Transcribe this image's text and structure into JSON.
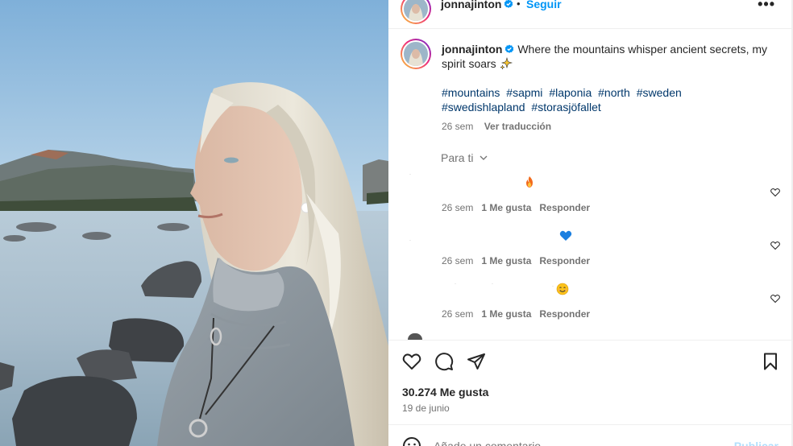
{
  "post": {
    "username": "jonnajinton",
    "separator": "•",
    "follow_label": "Seguir",
    "more_label": "•••",
    "caption_text": "Where the mountains whisper ancient secrets, my spirit soars",
    "caption_emoji": "sparkles-icon",
    "hashtags": [
      "#mountains",
      "#sapmi",
      "#laponia",
      "#north",
      "#sweden",
      "#swedishlapland",
      "#storasjöfallet"
    ],
    "caption_age": "26 sem",
    "translate_label": "Ver traducción",
    "sort_label": "Para ti",
    "likes": "30.274 Me gusta",
    "date": "19 de junio",
    "comment_placeholder": "Añade un comentario...",
    "publish_label": "Publicar"
  },
  "comments": [
    {
      "emoji": "fire-icon",
      "age": "26 sem",
      "likes": "1 Me gusta",
      "reply": "Responder"
    },
    {
      "emoji": "blue-heart-icon",
      "age": "26 sem",
      "likes": "1 Me gusta",
      "reply": "Responder"
    },
    {
      "emoji": "smiling-face-icon",
      "age": "26 sem",
      "likes": "1 Me gusta",
      "reply": "Responder"
    }
  ],
  "colors": {
    "link_blue": "#0095f6",
    "hashtag": "#00376b",
    "muted": "#737373",
    "verified": "#0095f6"
  }
}
